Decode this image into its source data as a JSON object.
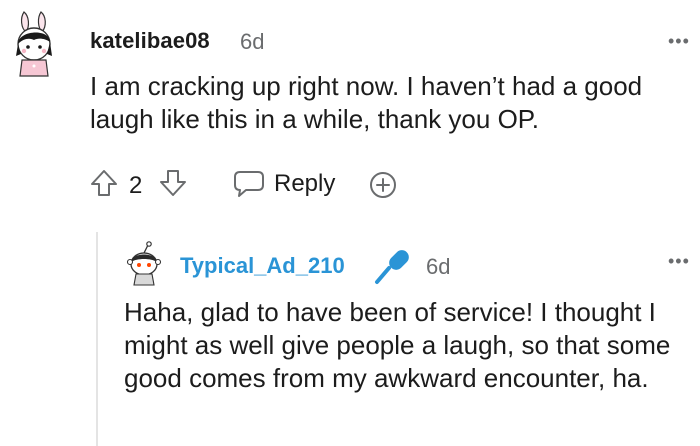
{
  "comment": {
    "username": "katelibae08",
    "age": "6d",
    "body": "I am cracking up right now. I haven’t had a good laugh like this in a while, thank you OP.",
    "actions": {
      "vote_count": "2",
      "reply_label": "Reply"
    },
    "icons": [
      "avatar",
      "more-options-icon",
      "upvote-icon",
      "downvote-icon",
      "reply-icon",
      "award-icon"
    ]
  },
  "reply": {
    "username": "Typical_Ad_210",
    "age": "6d",
    "body": "Haha, glad to have been of service! I thought I might as well give people a laugh, so that some good comes from my awkward encounter, ha.",
    "icons": [
      "avatar",
      "microphone-icon",
      "more-options-icon"
    ]
  },
  "colors": {
    "text": "#1c1c1c",
    "meta": "#6a6c6e",
    "reply_username": "#2a94d6",
    "thread_line": "#e4e4e4"
  }
}
